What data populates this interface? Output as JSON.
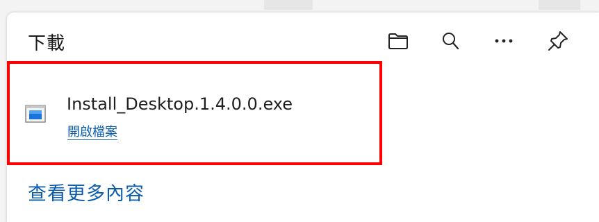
{
  "panel": {
    "title": "下載",
    "buttons": [
      {
        "name": "open-downloads-folder",
        "icon": "folder-icon"
      },
      {
        "name": "search-downloads",
        "icon": "search-icon"
      },
      {
        "name": "more-options",
        "icon": "more-horizontal-icon"
      },
      {
        "name": "pin-downloads",
        "icon": "pin-icon"
      }
    ]
  },
  "downloads": [
    {
      "file_name": "Install_Desktop.1.4.0.0.exe",
      "action_label": "開啟檔案",
      "icon": "exe-file-icon"
    }
  ],
  "footer": {
    "see_more_label": "查看更多內容"
  },
  "colors": {
    "link": "#0b5cad",
    "highlight_border": "#ff0000",
    "panel_bg": "#ffffff"
  }
}
